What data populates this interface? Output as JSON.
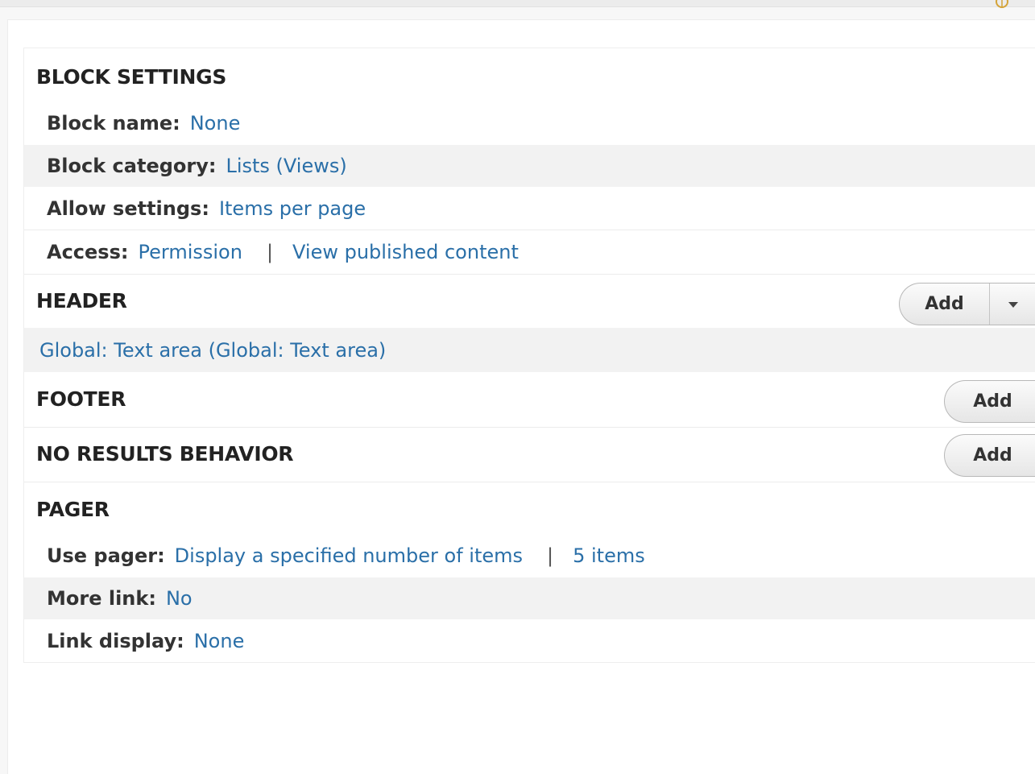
{
  "block_settings": {
    "title": "BLOCK SETTINGS",
    "block_name": {
      "label": "Block name:",
      "value": "None"
    },
    "block_category": {
      "label": "Block category:",
      "value": "Lists (Views)"
    },
    "allow_settings": {
      "label": "Allow settings:",
      "value": "Items per page"
    },
    "access": {
      "label": "Access:",
      "value": "Permission",
      "separator": "|",
      "value2": "View published content"
    }
  },
  "header": {
    "title": "HEADER",
    "add_label": "Add",
    "item": "Global: Text area (Global: Text area)"
  },
  "footer": {
    "title": "FOOTER",
    "add_label": "Add"
  },
  "no_results": {
    "title": "NO RESULTS BEHAVIOR",
    "add_label": "Add"
  },
  "pager": {
    "title": "PAGER",
    "use_pager": {
      "label": "Use pager:",
      "value": "Display a specified number of items",
      "separator": "|",
      "value2": "5 items"
    },
    "more_link": {
      "label": "More link:",
      "value": "No"
    },
    "link_display": {
      "label": "Link display:",
      "value": "None"
    }
  },
  "colors": {
    "link": "#2a6fa8",
    "alt_row": "#f2f2f2"
  },
  "icons": [
    "settings-gear-icon",
    "caret-down-icon"
  ]
}
